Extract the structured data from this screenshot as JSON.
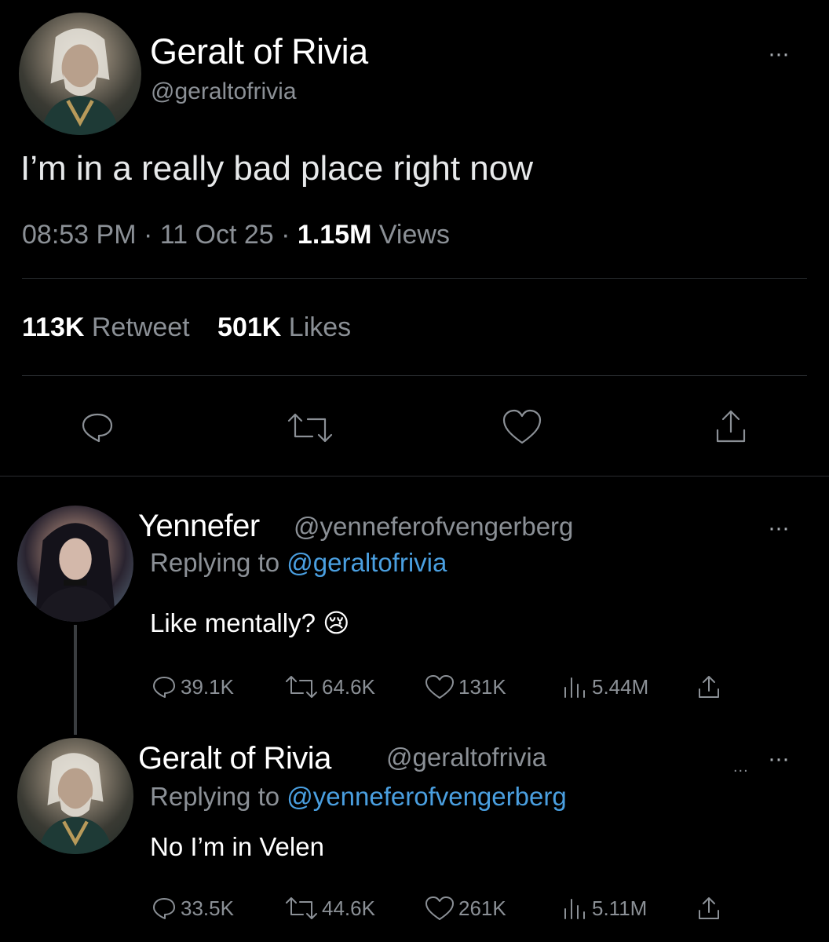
{
  "main_tweet": {
    "author_name": "Geralt of Rivia",
    "handle": "@geraltofrivia",
    "more": "···",
    "text": "I’m in a really bad place right now",
    "time": "08:53 PM",
    "sep1": "·",
    "date": "11 Oct 25",
    "sep2": "·",
    "views_count": "1.15M",
    "views_label": "Views",
    "retweet_count": "113K",
    "retweet_label": "Retweet",
    "likes_count": "501K",
    "likes_label": "Likes",
    "action_icons": [
      "reply-icon",
      "retweet-icon",
      "like-icon",
      "share-icon"
    ]
  },
  "replies": [
    {
      "author_name": "Yennefer",
      "handle": "@yenneferofvengerberg",
      "more": "···",
      "replying_prefix": "Replying to",
      "replying_to": "@geraltofrivia",
      "text": "Like mentally? 😢",
      "replies": "39.1K",
      "retweets": "64.6K",
      "likes": "131K",
      "views": "5.44M"
    },
    {
      "author_name": "Geralt of Rivia",
      "handle": "@geraltofrivia",
      "more": "···",
      "extra_dots": "...",
      "replying_prefix": "Replying to",
      "replying_to": "@yenneferofvengerberg",
      "text": "No I’m in Velen",
      "replies": "33.5K",
      "retweets": "44.6K",
      "likes": "261K",
      "views": "5.11M"
    }
  ],
  "colors": {
    "background": "#000000",
    "text": "#e7e9ea",
    "secondary": "#8b9096",
    "link": "#4a9fe0"
  }
}
